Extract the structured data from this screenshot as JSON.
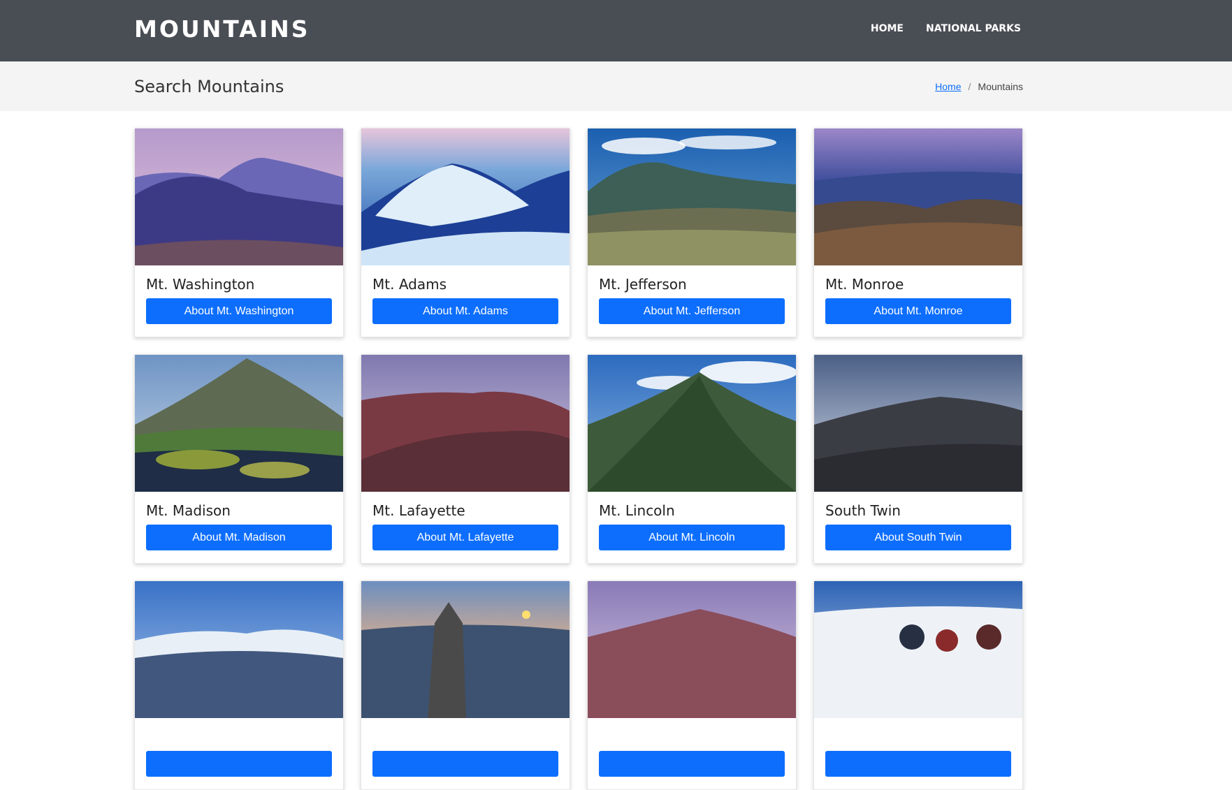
{
  "nav": {
    "brand": "MOUNTAINS",
    "links": [
      "HOME",
      "NATIONAL PARKS"
    ]
  },
  "subheader": {
    "title": "Search Mountains",
    "breadcrumb": {
      "home": "Home",
      "separator": "/",
      "current": "Mountains"
    }
  },
  "cards": [
    {
      "title": "Mt. Washington",
      "button": "About Mt. Washington"
    },
    {
      "title": "Mt. Adams",
      "button": "About Mt. Adams"
    },
    {
      "title": "Mt. Jefferson",
      "button": "About Mt. Jefferson"
    },
    {
      "title": "Mt. Monroe",
      "button": "About Mt. Monroe"
    },
    {
      "title": "Mt. Madison",
      "button": "About Mt. Madison"
    },
    {
      "title": "Mt. Lafayette",
      "button": "About Mt. Lafayette"
    },
    {
      "title": "Mt. Lincoln",
      "button": "About Mt. Lincoln"
    },
    {
      "title": "South Twin",
      "button": "About South Twin"
    },
    {
      "title": "",
      "button": ""
    },
    {
      "title": "",
      "button": ""
    },
    {
      "title": "",
      "button": ""
    },
    {
      "title": "",
      "button": ""
    }
  ],
  "colors": {
    "navbar": "#494d54",
    "subheader": "#f4f4f4",
    "button": "#0d6efd"
  }
}
